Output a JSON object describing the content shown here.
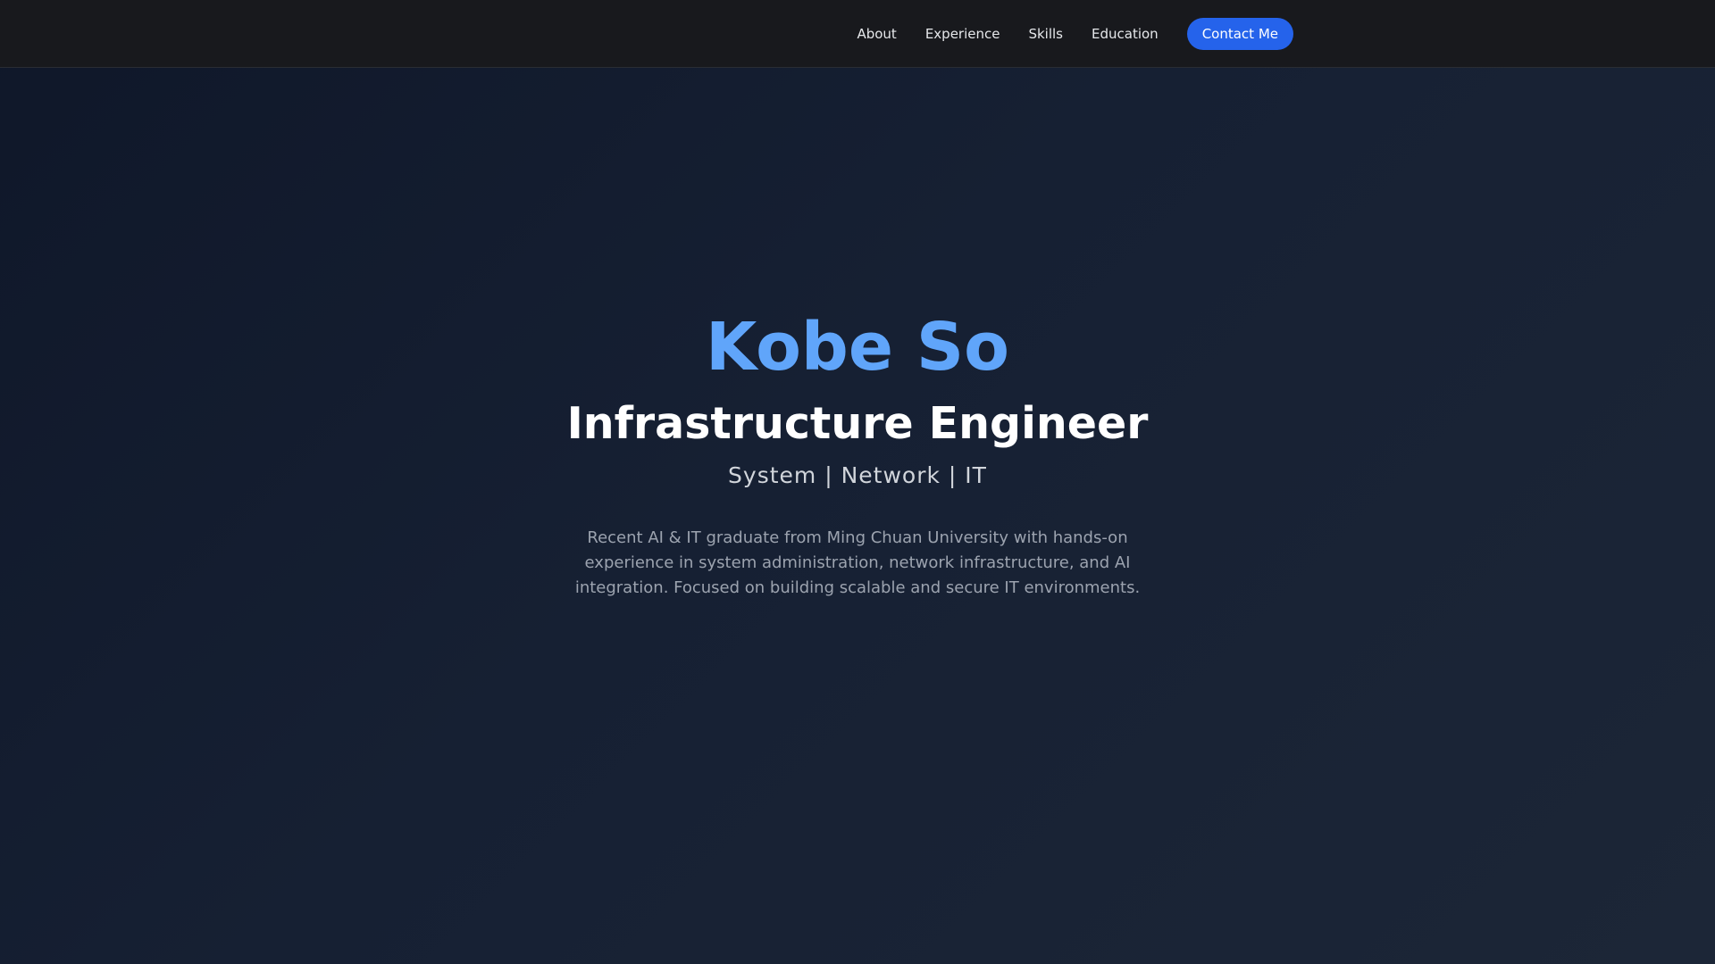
{
  "nav": {
    "links": [
      {
        "label": "About"
      },
      {
        "label": "Experience"
      },
      {
        "label": "Skills"
      },
      {
        "label": "Education"
      }
    ],
    "cta_label": "Contact Me"
  },
  "hero": {
    "name": "Kobe So",
    "title": "Infrastructure Engineer",
    "tagline": "System | Network | IT",
    "bio": "Recent AI & IT graduate from Ming Chuan University with hands-on experience in system administration, network infrastructure, and AI integration. Focused on building scalable and secure IT environments."
  },
  "colors": {
    "accent": "#2563eb",
    "name_color": "#60a5fa",
    "nav_background": "#18191d",
    "page_background": "#131c2e"
  }
}
